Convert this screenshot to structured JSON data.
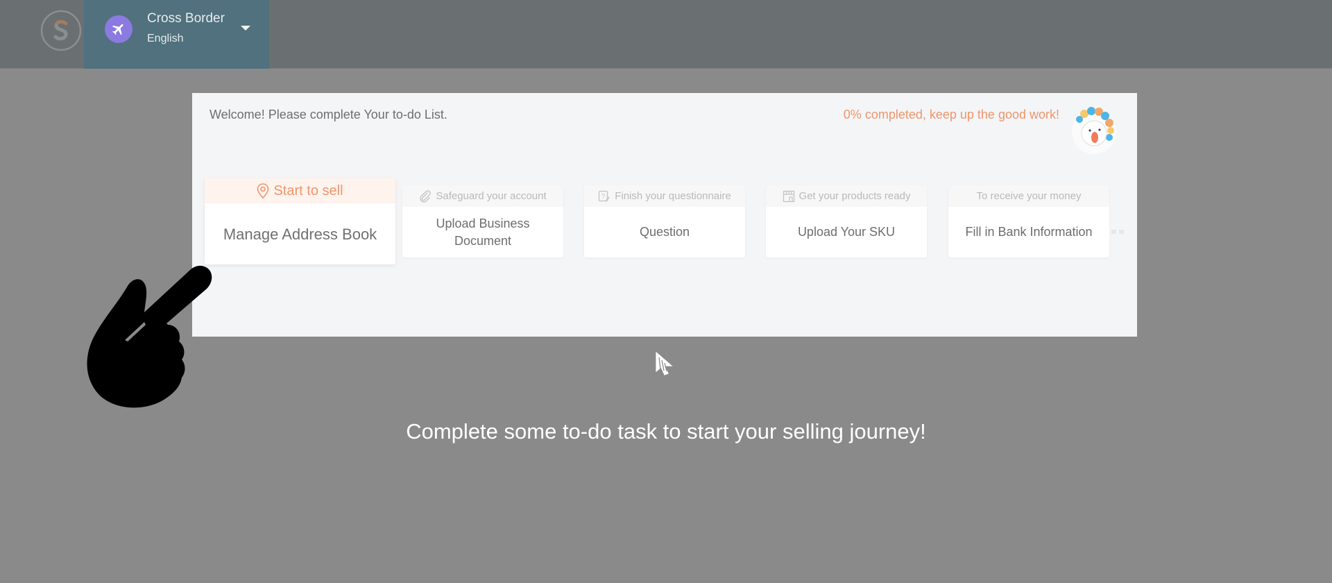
{
  "header": {
    "logo_icon": "shopee-s-logo-icon",
    "shop": {
      "icon": "airplane-icon",
      "name": "Cross Border",
      "language": "English",
      "dropdown_icon": "caret-down-icon"
    }
  },
  "todo": {
    "welcome": "Welcome! Please complete Your to-do List.",
    "progress_percent": 0,
    "progress_text": "0% completed, keep up the good work!",
    "mascot_icon": "mascot-icon",
    "steps": [
      {
        "category": "Start to sell",
        "icon": "location-pin-icon",
        "task": "Manage Address Book",
        "active": true
      },
      {
        "category": "Safeguard your account",
        "icon": "paperclip-icon",
        "task": "Upload Business Document",
        "active": false
      },
      {
        "category": "Finish your questionnaire",
        "icon": "questionnaire-icon",
        "task": "Question",
        "active": false
      },
      {
        "category": "Get your products ready",
        "icon": "shop-icon",
        "task": "Upload Your SKU",
        "active": false
      },
      {
        "category": "To receive your money",
        "icon": "",
        "task": "Fill in Bank Information",
        "active": false
      }
    ]
  },
  "overlay": {
    "hand_icon": "pointing-hand-icon",
    "cursor_icon": "mouse-cursor-icon",
    "message": "Complete some to-do task to start your selling journey!"
  },
  "colors": {
    "accent": "#f0956a",
    "header_bg": "#6a7071",
    "shop_switch_bg": "#50717d",
    "overlay_bg": "#8a8a8a"
  }
}
